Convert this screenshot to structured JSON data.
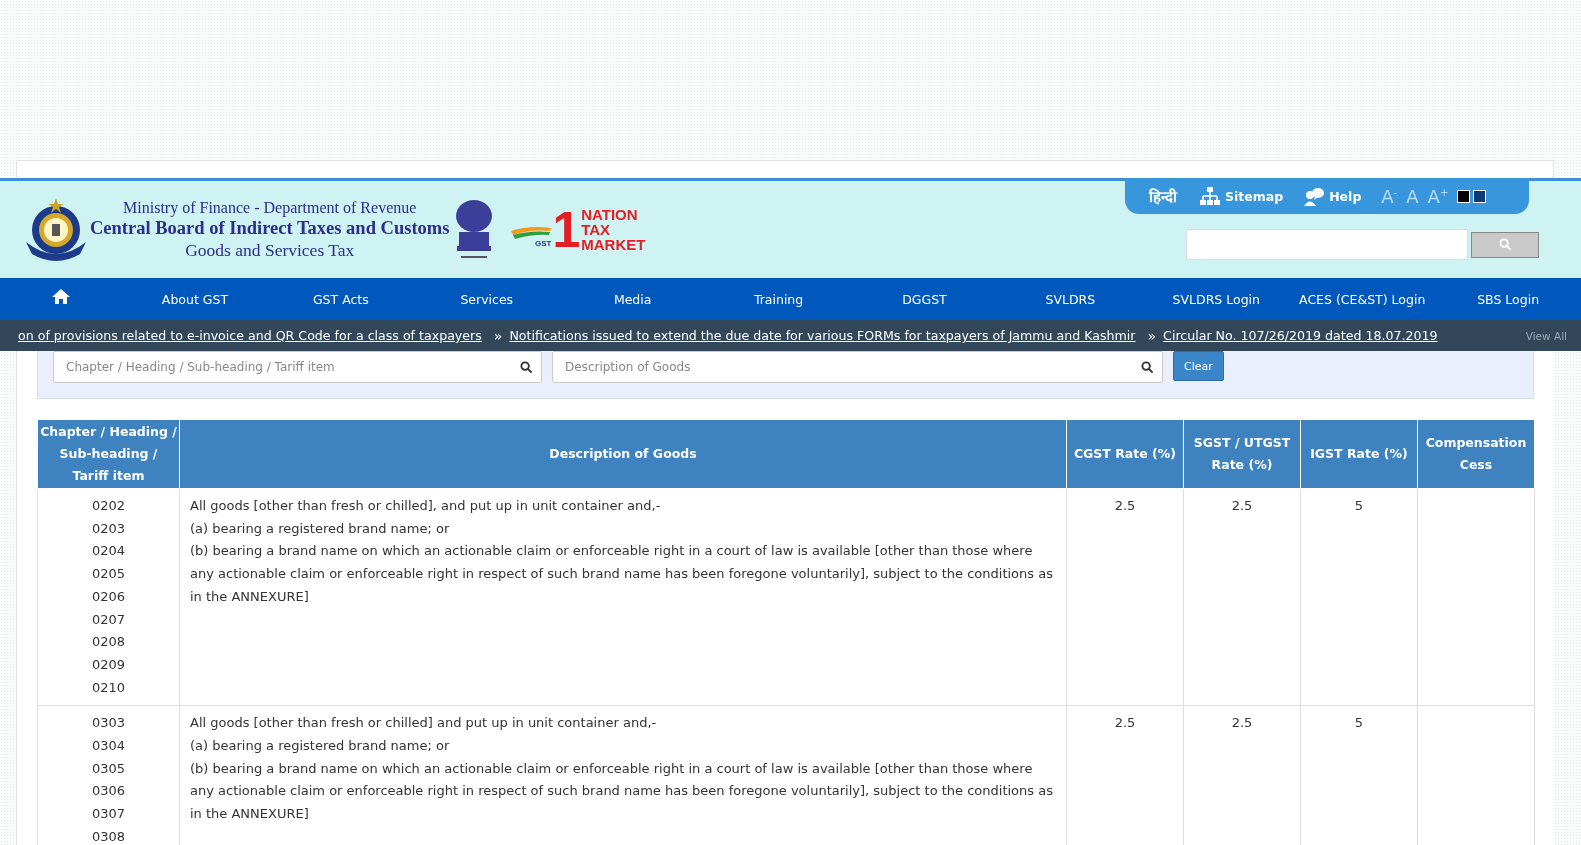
{
  "header": {
    "ministry": "Ministry of Finance - Department of Revenue",
    "board": "Central Board of Indirect Taxes and Customs",
    "subtitle": "Goods and Services Tax",
    "campaign_logo": {
      "numeral": "1",
      "badge": "GST",
      "words": [
        "NATION",
        "TAX",
        "MARKET"
      ]
    },
    "tools": {
      "language": "हिन्दी",
      "links": [
        {
          "kind": "sitemap",
          "label": "Sitemap"
        },
        {
          "kind": "help",
          "label": "Help"
        }
      ],
      "font_sizes": [
        {
          "label": "A$^{-}$"
        },
        {
          "label": "A"
        },
        {
          "label": "A$^{+}$"
        }
      ],
      "contrast_options": [
        {
          "color": "#000000"
        },
        {
          "color": "#0d3a73"
        }
      ]
    },
    "search": {
      "kind": "box"
    }
  },
  "nav": {
    "items": [
      "About GST",
      "GST Acts",
      "Services",
      "Media",
      "Training",
      "DGGST",
      "SVLDRS",
      "SVLDRS Login",
      "ACES (CE&ST) Login",
      "SBS Login"
    ]
  },
  "ticker": {
    "items": [
      "on of provisions related to e-invoice and QR Code for a class of taxpayers",
      "Notifications issued to extend the due date for various FORMs for taxpayers of Jammu and Kashmir",
      "Circular No. 107/26/2019 dated 18.07.2019"
    ],
    "separator": "»",
    "view_all": "View All"
  },
  "filters": {
    "fields": [
      {
        "placeholder": "Chapter / Heading / Sub-heading / Tariff item"
      },
      {
        "placeholder": "Description of Goods"
      }
    ],
    "clear": "Clear"
  },
  "table": {
    "columns": [
      "Chapter / Heading / Sub-heading / Tariff item",
      "Description of Goods",
      "CGST Rate (%)",
      "SGST / UTGST Rate (%)",
      "IGST Rate (%)",
      "Compensation Cess"
    ],
    "rows": [
      {
        "codes": [
          "0202",
          "0203",
          "0204",
          "0205",
          "0206",
          "0207",
          "0208",
          "0209",
          "0210"
        ],
        "description": [
          "All goods [other than fresh or chilled], and put up in unit container and,-",
          "(a) bearing a registered brand name; or",
          "(b) bearing a brand name on which an actionable claim or enforceable right in a court of law is available [other than those where any actionable claim or enforceable right in respect of such brand name has been foregone voluntarily], subject to the conditions as in the ANNEXURE]"
        ],
        "cgst": "2.5",
        "sgst": "2.5",
        "igst": "5"
      },
      {
        "codes": [
          "0303",
          "0304",
          "0305",
          "0306",
          "0307",
          "0308"
        ],
        "description": [
          "All goods [other than fresh or chilled] and put up in unit container and,-",
          "(a) bearing a registered brand name; or",
          "(b) bearing a brand name on which an actionable claim or enforceable right in a court of law is available [other than those where any actionable claim or enforceable right in respect of such brand name has been foregone voluntarily], subject to the conditions as in the ANNEXURE]"
        ],
        "cgst": "2.5",
        "sgst": "2.5",
        "igst": "5"
      }
    ]
  }
}
